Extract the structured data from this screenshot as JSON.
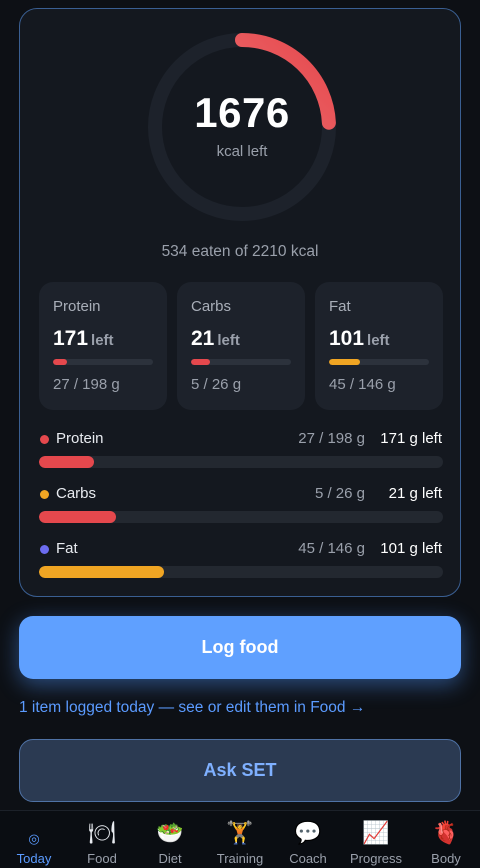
{
  "summary": {
    "kcal_left_value": "1676",
    "kcal_left_label": "kcal left",
    "eaten_text": "534 eaten of 2210 kcal",
    "progress_fraction": 0.242
  },
  "tiles": [
    {
      "name": "Protein",
      "value": "171",
      "left_word": "left",
      "amount": "27 / 198 g",
      "fill_fraction": 0.136,
      "color": "#e5484d"
    },
    {
      "name": "Carbs",
      "value": "21",
      "left_word": "left",
      "amount": "5 / 26 g",
      "fill_fraction": 0.19,
      "color": "#e5484d"
    },
    {
      "name": "Fat",
      "value": "101",
      "left_word": "left",
      "amount": "45 / 146 g",
      "fill_fraction": 0.31,
      "color": "#f0a523"
    }
  ],
  "rows": [
    {
      "name": "Protein",
      "amount": "27 / 198 g",
      "left": "171 g left",
      "dot_color": "#e5484d",
      "fill_fraction": 0.136,
      "color": "#e5484d"
    },
    {
      "name": "Carbs",
      "amount": "5 / 26 g",
      "left": "21 g left",
      "dot_color": "#f0a523",
      "fill_fraction": 0.19,
      "color": "#e5484d"
    },
    {
      "name": "Fat",
      "amount": "45 / 146 g",
      "left": "101 g left",
      "dot_color": "#6c6cf0",
      "fill_fraction": 0.31,
      "color": "#f0a523"
    }
  ],
  "actions": {
    "log_food_label": "Log food",
    "log_link_text": "1 item logged today — see or edit them in Food →",
    "ask_label": "Ask SET"
  },
  "tabs": [
    {
      "label": "Today",
      "icon": "target-icon",
      "glyph": "◎",
      "active": true
    },
    {
      "label": "Food",
      "icon": "plate-cutlery-icon",
      "glyph": "🍽",
      "active": false
    },
    {
      "label": "Diet",
      "icon": "salad-icon",
      "glyph": "🥗",
      "active": false
    },
    {
      "label": "Training",
      "icon": "weightlifter-icon",
      "glyph": "🏋",
      "active": false
    },
    {
      "label": "Coach",
      "icon": "speech-bubble-icon",
      "glyph": "💬",
      "active": false
    },
    {
      "label": "Progress",
      "icon": "chart-up-icon",
      "glyph": "📈",
      "active": false
    },
    {
      "label": "Body",
      "icon": "heart-anatomical-icon",
      "glyph": "🫀",
      "active": false
    }
  ],
  "colors": {
    "accent": "#5b9bff",
    "ring_start": "#f07a7a",
    "ring_end": "#e5484d",
    "ring_track": "#1d222b"
  }
}
